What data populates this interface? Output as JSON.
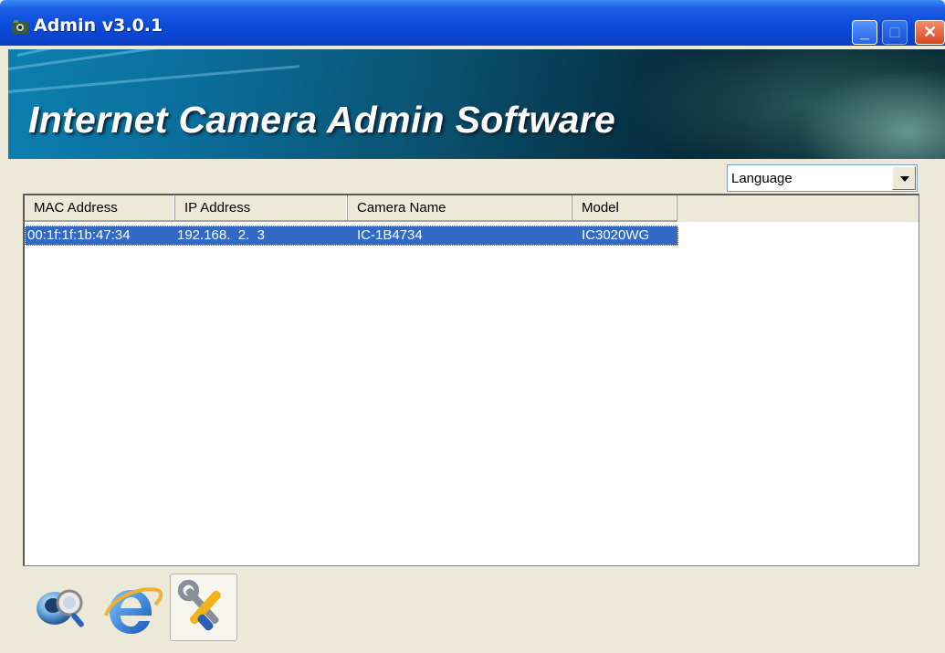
{
  "window": {
    "title": "Admin v3.0.1",
    "minimize_label": "_",
    "maximize_label": "□",
    "close_label": "✕"
  },
  "banner": {
    "title": "Internet Camera Admin Software"
  },
  "language_select": {
    "value": "Language"
  },
  "camera_list": {
    "columns": [
      "MAC Address",
      "IP Address",
      "Camera Name",
      "Model"
    ],
    "rows": [
      {
        "mac": "00:1f:1f:1b:47:34",
        "ip": "192.168.  2.  3",
        "name": "IC-1B4734",
        "model": "IC3020WG",
        "selected": true
      }
    ]
  },
  "toolbar": {
    "icons": [
      "search-camera-icon",
      "internet-explorer-icon",
      "tools-icon"
    ]
  },
  "colors": {
    "titlebar": "#0a4ad8",
    "selection": "#316ac5",
    "window_bg": "#ece9d8"
  }
}
